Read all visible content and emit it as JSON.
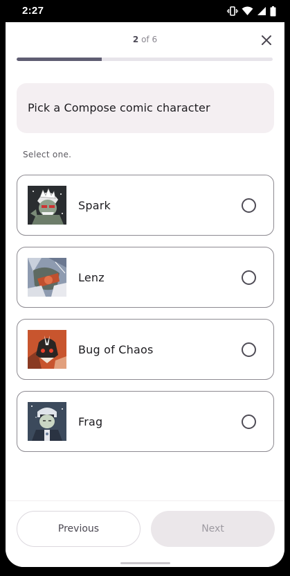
{
  "status_bar": {
    "time": "2:27",
    "icons": [
      "vibrate-icon",
      "wifi-icon",
      "signal-icon",
      "battery-icon"
    ]
  },
  "header": {
    "step_current": "2",
    "step_separator": "of",
    "step_total": "6",
    "progress_fraction": 0.333,
    "close_icon": "close-icon"
  },
  "question": {
    "text": "Pick a Compose comic character",
    "instruction": "Select one."
  },
  "options": [
    {
      "label": "Spark",
      "selected": false
    },
    {
      "label": "Lenz",
      "selected": false
    },
    {
      "label": "Bug of Chaos",
      "selected": false
    },
    {
      "label": "Frag",
      "selected": false
    }
  ],
  "footer": {
    "previous_label": "Previous",
    "next_label": "Next",
    "next_enabled": false
  },
  "colors": {
    "accent": "#5f5d72",
    "card_background": "#f4eff2",
    "disabled_button": "#ebe7ea"
  }
}
